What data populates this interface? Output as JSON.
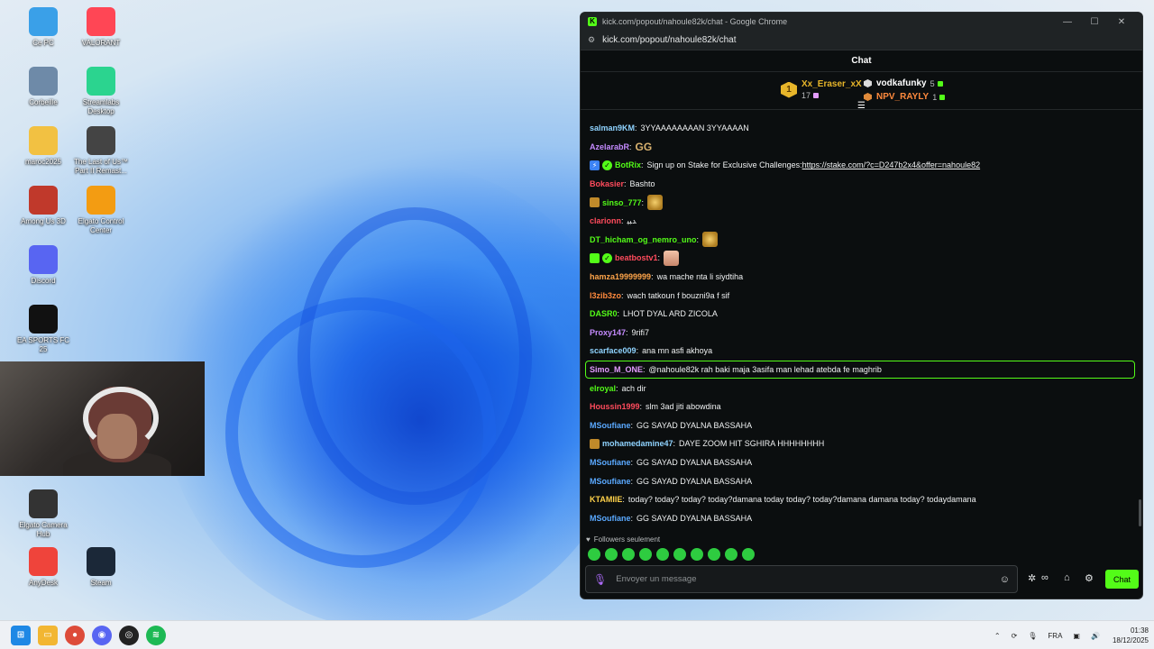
{
  "desktop": {
    "icons": [
      {
        "label": "Ce PC",
        "icon": "monitor-icon"
      },
      {
        "label": "VALORANT",
        "icon": "valorant-icon"
      },
      {
        "label": "Corbeille",
        "icon": "recycle-bin-icon"
      },
      {
        "label": "Streamlabs Desktop",
        "icon": "streamlabs-icon"
      },
      {
        "label": "maroc2025",
        "icon": "folder-icon"
      },
      {
        "label": "The Last of Us™ Part II Remast...",
        "icon": "game-icon"
      },
      {
        "label": "Among Us 3D",
        "icon": "among-us-icon"
      },
      {
        "label": "Elgato Control Center",
        "icon": "elgato-control-icon"
      },
      {
        "label": "Discord",
        "icon": "discord-icon"
      },
      {
        "label": "EA SPORTS FC 25",
        "icon": "fc25-icon"
      },
      {
        "label": "Elgato Camera Hub",
        "icon": "elgato-camera-icon"
      },
      {
        "label": "AnyDesk",
        "icon": "anydesk-icon"
      },
      {
        "label": "Steam",
        "icon": "steam-icon"
      }
    ]
  },
  "window": {
    "title": "kick.com/popout/nahoule82k/chat - Google Chrome",
    "url": "kick.com/popout/nahoule82k/chat"
  },
  "chat": {
    "header": "Chat",
    "leaderboard": {
      "first": {
        "rank": "1",
        "name": "Xx_Eraser_xX",
        "count": "17"
      },
      "second": {
        "name": "vodkafunky",
        "count": "5"
      },
      "third": {
        "name": "NPV_RAYLY",
        "count": "1"
      }
    },
    "messages": [
      {
        "user": "salman9KM",
        "color": "#8fd3ff",
        "text": "3YYAAAAAAAAN 3YYAAAAN"
      },
      {
        "user": "AzelarabR",
        "color": "#c58bff",
        "emote": "GG",
        "text": ""
      },
      {
        "user": "BotRix",
        "color": "#53fc18",
        "badges": [
          "bot",
          "verif"
        ],
        "text": "Sign up on Stake for Exclusive Challenges: ",
        "link": "https://stake.com/?c=D247b2x4&offer=nahoule82"
      },
      {
        "user": "Bokasier",
        "color": "#ff4b5c",
        "text": "Bashto"
      },
      {
        "user": "sinso_777",
        "color": "#53fc18",
        "badges": [
          "og"
        ],
        "emote": "gold",
        "text": ""
      },
      {
        "user": "clarionn",
        "color": "#ff4b5c",
        "text": "ﺪﺒﻴ"
      },
      {
        "user": "DT_hicham_og_nemro_uno",
        "color": "#53fc18",
        "emote": "gold",
        "text": ""
      },
      {
        "user": "beatbostv1",
        "color": "#ff4b5c",
        "badges": [
          "sub",
          "verif"
        ],
        "emote": "face",
        "text": ""
      },
      {
        "user": "hamza19999999",
        "color": "#ffa54a",
        "text": "wa mache nta li siydtiha"
      },
      {
        "user": "l3zib3zo",
        "color": "#ff8a3d",
        "text": "wach tatkoun f bouzni9a f sif"
      },
      {
        "user": "DASR0",
        "color": "#53fc18",
        "text": "LHOT DYAL ARD ZICOLA"
      },
      {
        "user": "Proxy147",
        "color": "#c58bff",
        "text": "9rifi7"
      },
      {
        "user": "scarface009",
        "color": "#8fd3ff",
        "text": "ana mn asfi akhoya"
      },
      {
        "user": "Simo_M_ONE",
        "color": "#e39cff",
        "text": "@nahoule82k rah baki maja 3asifa man lehad atebda fe maghrib",
        "highlight": true
      },
      {
        "user": "elroyal",
        "color": "#53fc18",
        "text": "ach dir"
      },
      {
        "user": "Houssin1999",
        "color": "#ff4b5c",
        "text": "slm 3ad jiti abowdina"
      },
      {
        "user": "MSoufiane",
        "color": "#5aa9ff",
        "text": "GG SAYAD DYALNA BASSAHA"
      },
      {
        "user": "mohamedamine47",
        "color": "#8fd3ff",
        "badges": [
          "og"
        ],
        "text": "DAYE ZOOM HIT SGHIRA HHHHHHHH"
      },
      {
        "user": "MSoufiane",
        "color": "#5aa9ff",
        "text": "GG SAYAD DYALNA BASSAHA"
      },
      {
        "user": "MSoufiane",
        "color": "#5aa9ff",
        "text": "GG SAYAD DYALNA BASSAHA"
      },
      {
        "user": "KTAMIIE",
        "color": "#ffd24a",
        "text": "today? today? today? today?damana today today? today?damana damana today? todaydamana"
      },
      {
        "user": "MSoufiane",
        "color": "#5aa9ff",
        "text": "GG SAYAD DYALNA BASSAHA"
      }
    ],
    "followers_mode": "Followers seulement",
    "input_placeholder": "Envoyer un message",
    "send_label": "Chat"
  },
  "taskbar": {
    "language": "FRA",
    "time": "01:38",
    "date": "18/12/2025"
  }
}
